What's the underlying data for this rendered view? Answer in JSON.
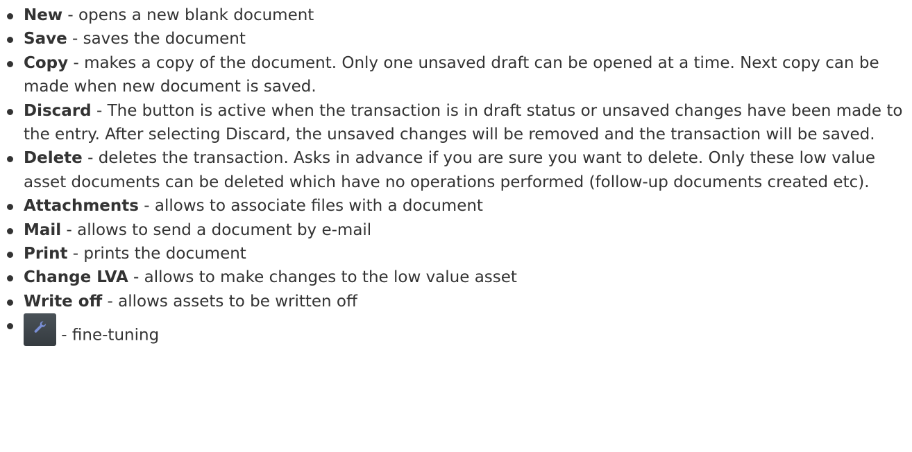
{
  "separator": " - ",
  "items": [
    {
      "term": "New",
      "desc": "opens a new blank document"
    },
    {
      "term": "Save",
      "desc": "saves the document"
    },
    {
      "term": "Copy",
      "desc": "makes a copy of the document. Only one unsaved draft can be opened at a time. Next copy can be made when new document is saved."
    },
    {
      "term": "Discard",
      "desc": "The button is active when the transaction is in draft status or unsaved changes have been made to the entry. After selecting Discard, the unsaved changes will be removed and the transaction will be saved."
    },
    {
      "term": "Delete",
      "desc": "deletes the transaction. Asks in advance if you are sure you want to delete. Only these low value asset documents can be deleted which have no operations performed (follow-up documents created etc)."
    },
    {
      "term": "Attachments",
      "desc": "allows to associate files with a document"
    },
    {
      "term": "Mail",
      "desc": "allows to send a document by e-mail"
    },
    {
      "term": "Print",
      "desc": "prints the document"
    },
    {
      "term": "Change LVA",
      "desc": "allows to make changes to the low value asset"
    },
    {
      "term": "Write off",
      "desc": "allows assets to be written off"
    }
  ],
  "icon_item": {
    "icon": "wrench-icon",
    "desc": "fine-tuning"
  },
  "colors": {
    "text": "#333333",
    "icon_button_bg": "#3d4348",
    "icon_glyph": "#7a8fd6"
  }
}
